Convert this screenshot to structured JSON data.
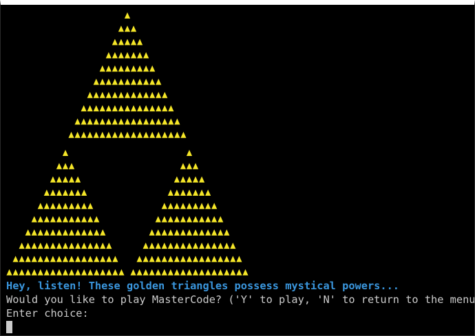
{
  "terminal": {
    "art": {
      "glyph": "▲",
      "glyph_color": "#f5e628",
      "top_triangle_rows": [
        1,
        3,
        5,
        7,
        9,
        11,
        13,
        15,
        17,
        19
      ],
      "bottom_triangle_rows": [
        1,
        3,
        5,
        7,
        9,
        11,
        13,
        15,
        17,
        19
      ]
    },
    "message": "Hey, listen! These golden triangles possess mystical powers...",
    "message_color": "#3a96dd",
    "prompt": "Would you like to play MasterCode? ('Y' to play, 'N' to return to the menu)",
    "entry_label": "Enter choice:",
    "text_color": "#cccccc",
    "background": "#000000"
  }
}
